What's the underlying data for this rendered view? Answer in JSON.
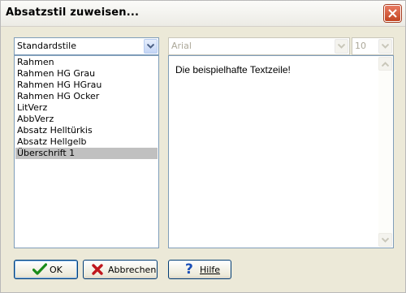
{
  "window": {
    "title": "Absatzstil zuweisen..."
  },
  "style_category": {
    "selected": "Standardstile"
  },
  "style_list": {
    "items": [
      {
        "label": "Rahmen",
        "selected": false
      },
      {
        "label": "Rahmen HG Grau",
        "selected": false
      },
      {
        "label": "Rahmen HG HGrau",
        "selected": false
      },
      {
        "label": "Rahmen HG Ocker",
        "selected": false
      },
      {
        "label": "LitVerz",
        "selected": false
      },
      {
        "label": "AbbVerz",
        "selected": false
      },
      {
        "label": "Absatz Helltürkis",
        "selected": false
      },
      {
        "label": "Absatz Hellgelb",
        "selected": false
      },
      {
        "label": "Überschrift 1",
        "selected": true
      }
    ]
  },
  "font": {
    "name": "Arial",
    "size": "10"
  },
  "preview": {
    "text": "Die beispielhafte Textzeile!"
  },
  "buttons": {
    "ok": "OK",
    "cancel": "Abbrechen",
    "help": "Hilfe"
  },
  "colors": {
    "dialog_bg": "#ece9d8",
    "selection": "#c0c0c0",
    "ok_check": "#1a8c1a",
    "cancel_x": "#c0161d",
    "help_q": "#1b4fb8"
  }
}
